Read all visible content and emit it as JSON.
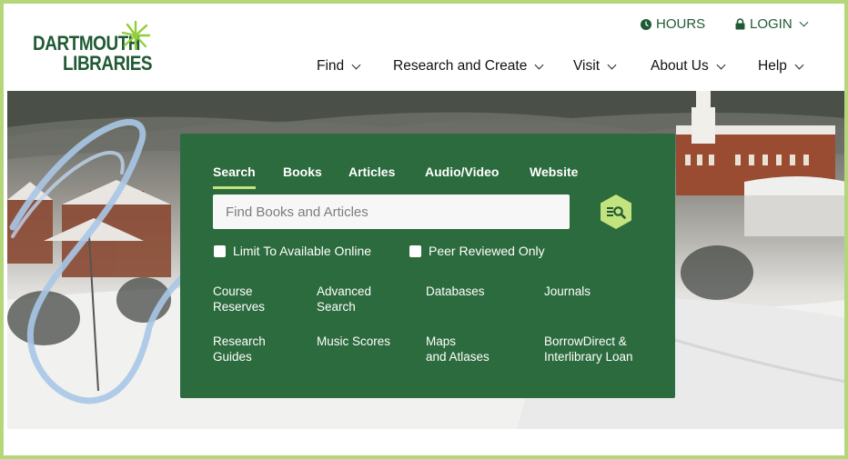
{
  "logo": {
    "line1": "DARTMOUTH",
    "line2": "LIBRARIES"
  },
  "utility": {
    "hours": "HOURS",
    "login": "LOGIN"
  },
  "nav": [
    {
      "label": "Find"
    },
    {
      "label": "Research and Create"
    },
    {
      "label": "Visit"
    },
    {
      "label": "About Us"
    },
    {
      "label": "Help"
    }
  ],
  "search": {
    "tabs": [
      "Search",
      "Books",
      "Articles",
      "Audio/Video",
      "Website"
    ],
    "active_tab": "Search",
    "placeholder": "Find Books and Articles",
    "checkboxes": [
      "Limit To Available Online",
      "Peer Reviewed Only"
    ],
    "links": [
      "Course\nReserves",
      "Advanced\nSearch",
      "Databases",
      "Journals",
      "Research\nGuides",
      "Music Scores",
      "Maps\nand Atlases",
      "BorrowDirect &\nInterlibrary Loan"
    ]
  },
  "colors": {
    "brand_green": "#2c6b3d",
    "accent_lime": "#c3e37e",
    "frame": "#b4d77a"
  }
}
